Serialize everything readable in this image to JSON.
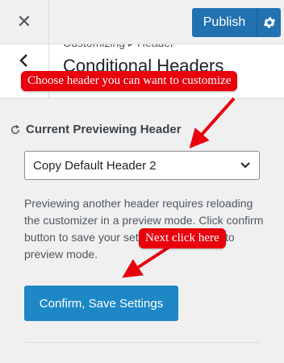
{
  "topbar": {
    "close_icon": "close-icon",
    "publish_label": "Publish",
    "settings_icon": "gear-icon"
  },
  "section": {
    "back_icon": "chevron-left-icon",
    "breadcrumb": "Customizing ▸ Header",
    "title": "Conditional Headers"
  },
  "panel": {
    "current_label": "Current Previewing Header",
    "reload_icon": "refresh-icon",
    "select_value": "Copy Default Header 2",
    "description": "Previewing another header requires reloading the customizer in a preview mode. Click confirm button to save your settings and enter into preview mode.",
    "confirm_label": "Confirm, Save Settings"
  },
  "annotations": {
    "note_1": "Choose header you can want to customize",
    "note_2": "Next click here"
  },
  "colors": {
    "primary": "#2271b1",
    "confirm_button": "#1e87c6",
    "annotation": "#e8000d"
  }
}
